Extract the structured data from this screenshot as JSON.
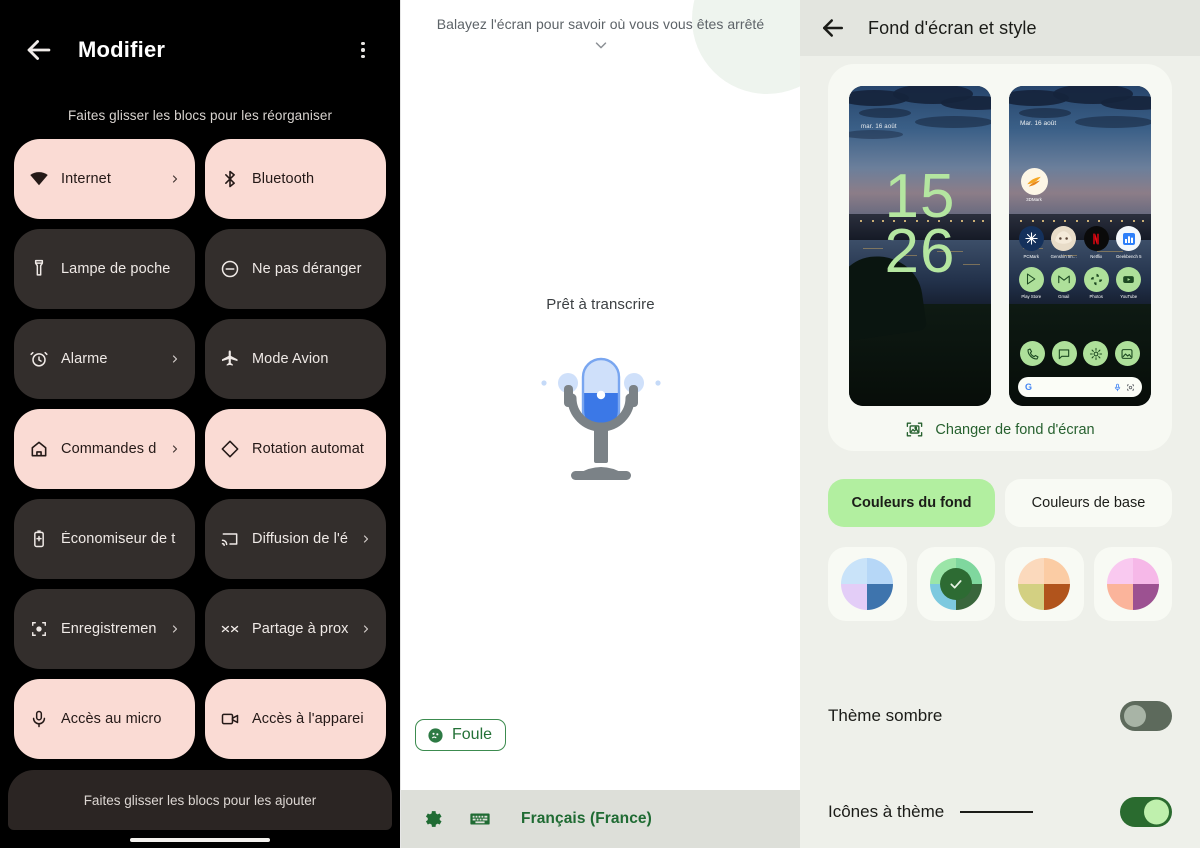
{
  "quick_settings": {
    "title": "Modifier",
    "back_icon": "arrow-left-icon",
    "overflow_icon": "more-vert-icon",
    "hint_top": "Faites glisser les blocs pour les réorganiser",
    "hint_bottom": "Faites glisser les blocs pour les ajouter",
    "tiles": [
      {
        "label": "Internet",
        "icon": "wifi-icon",
        "state": "on",
        "chevron": true
      },
      {
        "label": "Bluetooth",
        "icon": "bluetooth-icon",
        "state": "on",
        "chevron": false
      },
      {
        "label": "Lampe de poche",
        "icon": "flashlight-icon",
        "state": "off",
        "chevron": false
      },
      {
        "label": "Ne pas déranger",
        "icon": "do-not-disturb-icon",
        "state": "off",
        "chevron": false
      },
      {
        "label": "Alarme",
        "icon": "alarm-icon",
        "state": "off",
        "chevron": true
      },
      {
        "label": "Mode Avion",
        "icon": "airplane-icon",
        "state": "off",
        "chevron": false
      },
      {
        "label": "Commandes d",
        "icon": "home-icon",
        "state": "on",
        "chevron": true
      },
      {
        "label": "Rotation automat",
        "icon": "screen-rotation-icon",
        "state": "on",
        "chevron": false
      },
      {
        "label": "Économiseur de t",
        "icon": "battery-saver-icon",
        "state": "off",
        "chevron": false
      },
      {
        "label": "Diffusion de l'é",
        "icon": "cast-icon",
        "state": "off",
        "chevron": true
      },
      {
        "label": "Enregistremen",
        "icon": "record-icon",
        "state": "off",
        "chevron": true
      },
      {
        "label": "Partage à prox",
        "icon": "nearby-share-icon",
        "state": "off",
        "chevron": true
      },
      {
        "label": "Accès au micro",
        "icon": "microphone-icon",
        "state": "on",
        "chevron": false
      },
      {
        "label": "Accès à l'apparei",
        "icon": "camera-icon",
        "state": "on",
        "chevron": false
      }
    ],
    "colors": {
      "tile_on": "#FADBD4",
      "tile_off": "#332E2C",
      "background": "#000000"
    }
  },
  "transcribe": {
    "hint": "Balayez l'écran pour savoir où vous vous êtes arrêté",
    "chevron_icon": "chevron-down-icon",
    "status": "Prêt à transcrire",
    "mic_icon": "microphone-illustration",
    "tag_label": "Foule",
    "tag_icon": "sound-event-icon",
    "settings_icon": "gear-icon",
    "keyboard_icon": "keyboard-icon",
    "language": "Français (France)",
    "colors": {
      "accent_green": "#247137",
      "mic_blue": "#3B78E7",
      "bar_bg": "#DDDFD9"
    }
  },
  "wallpaper": {
    "title": "Fond d'écran et style",
    "back_icon": "arrow-left-icon",
    "change_wallpaper_label": "Changer de fond d'écran",
    "change_wallpaper_icon": "image-frame-icon",
    "lock_screen": {
      "date": "mar. 16 août",
      "clock_hours": "15",
      "clock_minutes": "26"
    },
    "home_screen": {
      "date": "Mar. 16 août",
      "widget": {
        "label": "3DMark",
        "icon": "3dmark-icon"
      },
      "row1": [
        {
          "label": "PCMark",
          "icon": "pcmark-icon"
        },
        {
          "label": "Genshin Im…",
          "icon": "genshin-icon"
        },
        {
          "label": "Netflix",
          "icon": "netflix-icon"
        },
        {
          "label": "Geekbench 5",
          "icon": "geekbench-icon"
        }
      ],
      "row2": [
        {
          "label": "Play Store",
          "icon": "play-store-icon"
        },
        {
          "label": "Gmail",
          "icon": "gmail-icon"
        },
        {
          "label": "Photos",
          "icon": "photos-icon"
        },
        {
          "label": "YouTube",
          "icon": "youtube-icon"
        }
      ],
      "dock": [
        {
          "label": "Téléphone",
          "icon": "phone-icon"
        },
        {
          "label": "Messages",
          "icon": "messages-icon"
        },
        {
          "label": "Paramètres",
          "icon": "gear-icon"
        },
        {
          "label": "Galerie",
          "icon": "gallery-icon"
        }
      ],
      "search": {
        "logo": "G",
        "mic_icon": "microphone-icon",
        "lens_icon": "google-lens-icon"
      }
    },
    "tabs": [
      {
        "label": "Couleurs du fond",
        "active": true
      },
      {
        "label": "Couleurs de base",
        "active": false
      }
    ],
    "swatches": [
      {
        "name": "swatch-blue-lilac",
        "selected": false,
        "quadrants": [
          "#B6D7F7",
          "#C9E3F9",
          "#E3CDF7",
          "#3E74AD"
        ]
      },
      {
        "name": "swatch-green",
        "selected": true,
        "quadrants": [
          "#7FD79E",
          "#9BE5A8",
          "#7DC9DF",
          "#39663C"
        ]
      },
      {
        "name": "swatch-orange",
        "selected": false,
        "quadrants": [
          "#FBCCA4",
          "#FBD9BC",
          "#D3D082",
          "#B1541C"
        ]
      },
      {
        "name": "swatch-pink",
        "selected": false,
        "quadrants": [
          "#F6B8E8",
          "#F9C9F0",
          "#FBB49B",
          "#9C5191"
        ]
      }
    ],
    "settings": [
      {
        "label": "Thème sombre",
        "toggle": "off",
        "has_dash": false
      },
      {
        "label": "Icônes à thème",
        "toggle": "on",
        "has_dash": true
      }
    ],
    "colors": {
      "header_bg": "#E3E5DF",
      "body_bg": "#EEF0EA",
      "card_bg": "#F7F9F3",
      "tab_active": "#B2EFA0",
      "accent": "#27612F"
    }
  }
}
